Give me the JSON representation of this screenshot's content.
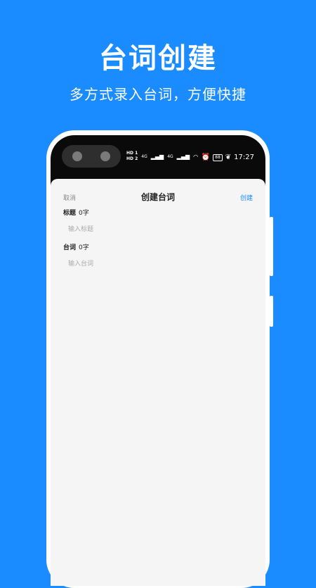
{
  "hero": {
    "title": "台词创建",
    "subtitle": "多方式录入台词，方便快捷"
  },
  "status_bar": {
    "left_hd1": "HD 1",
    "left_hd2": "HD 2",
    "left_net1": "4G",
    "left_net2": "4G",
    "battery": "88",
    "time": "17:27"
  },
  "nav": {
    "cancel": "取消",
    "title": "创建台词",
    "create": "创建"
  },
  "form": {
    "title_label": "标题",
    "title_count": "0字",
    "title_placeholder": "输入标题",
    "lines_label": "台词",
    "lines_count": "0字",
    "lines_placeholder": "输入台词"
  },
  "colors": {
    "background": "#1a8cff",
    "accent": "#1a8cff"
  }
}
